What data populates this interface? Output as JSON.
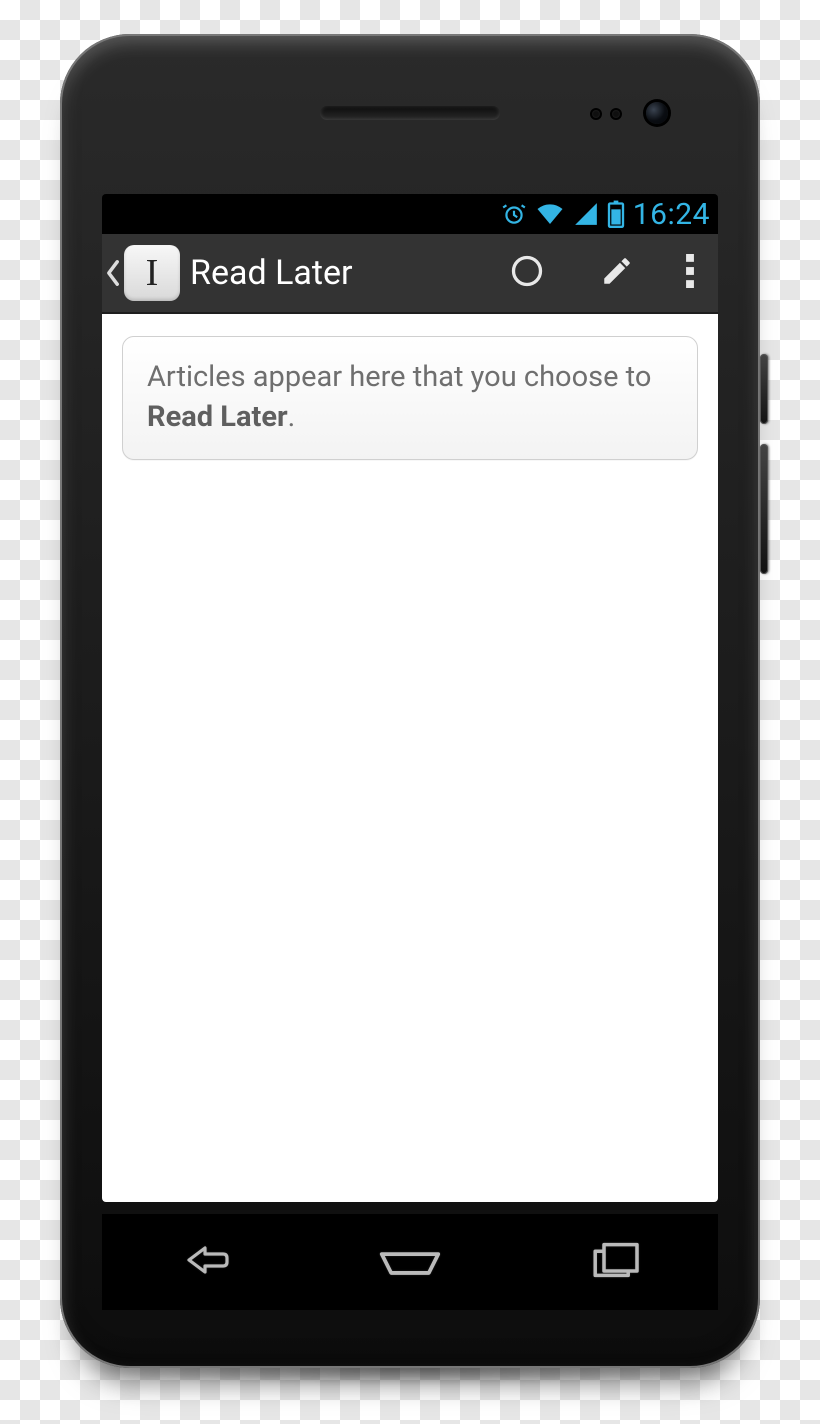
{
  "status": {
    "time": "16:24",
    "icons": {
      "alarm": "alarm-icon",
      "wifi": "wifi-icon",
      "signal": "signal-icon",
      "battery": "battery-icon"
    }
  },
  "appbar": {
    "app_icon_letter": "I",
    "title": "Read Later",
    "actions": {
      "refresh": "refresh",
      "edit": "edit",
      "overflow": "more"
    }
  },
  "content": {
    "hint_prefix": "Articles appear here that you choose to ",
    "hint_bold": "Read Later",
    "hint_suffix": "."
  },
  "navbar": {
    "back": "back",
    "home": "home",
    "recent": "recent"
  }
}
